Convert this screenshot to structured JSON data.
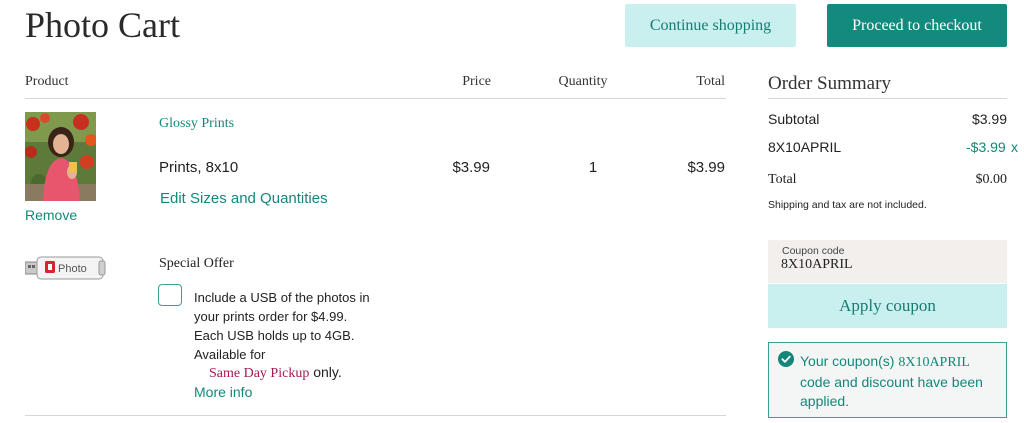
{
  "header": {
    "title": "Photo Cart",
    "continue_label": "Continue shopping",
    "checkout_label": "Proceed to checkout"
  },
  "table": {
    "columns": [
      "Product",
      "Price",
      "Quantity",
      "Total"
    ]
  },
  "cart_item": {
    "name": "Glossy Prints",
    "description": "Prints, 8x10",
    "edit_label": "Edit Sizes and Quantities",
    "remove_label": "Remove",
    "price": "$3.99",
    "quantity": "1",
    "total": "$3.99",
    "thumbnail_icon": "photo-thumbnail"
  },
  "special_offer": {
    "title": "Special Offer",
    "usb_label": "Photo",
    "checked": false,
    "lines": [
      "Include a USB of the photos in",
      "your prints order for $4.99.",
      "Each USB holds up to 4GB.",
      "Available for"
    ],
    "pickup_label": "Same Day Pickup",
    "pickup_suffix": " only.",
    "more_info_label": "More info"
  },
  "summary": {
    "title": "Order Summary",
    "subtotal_label": "Subtotal",
    "subtotal_value": "$3.99",
    "coupon_name": "8X10APRIL",
    "coupon_value": "-$3.99",
    "coupon_remove": "x",
    "total_label": "Total",
    "total_value": "$0.00",
    "note": "Shipping and tax are not included."
  },
  "coupon": {
    "field_label": "Coupon code",
    "field_value": "8X10APRIL",
    "apply_label": "Apply coupon"
  },
  "success": {
    "icon": "check-circle-icon",
    "prefix": "Your coupon(s) ",
    "code": "8X10APRIL",
    "suffix": "code and discount have been applied."
  },
  "colors": {
    "accent": "#14877a",
    "button_primary": "#138a7e",
    "button_secondary": "#c9efef",
    "pickup": "#a41a55"
  }
}
